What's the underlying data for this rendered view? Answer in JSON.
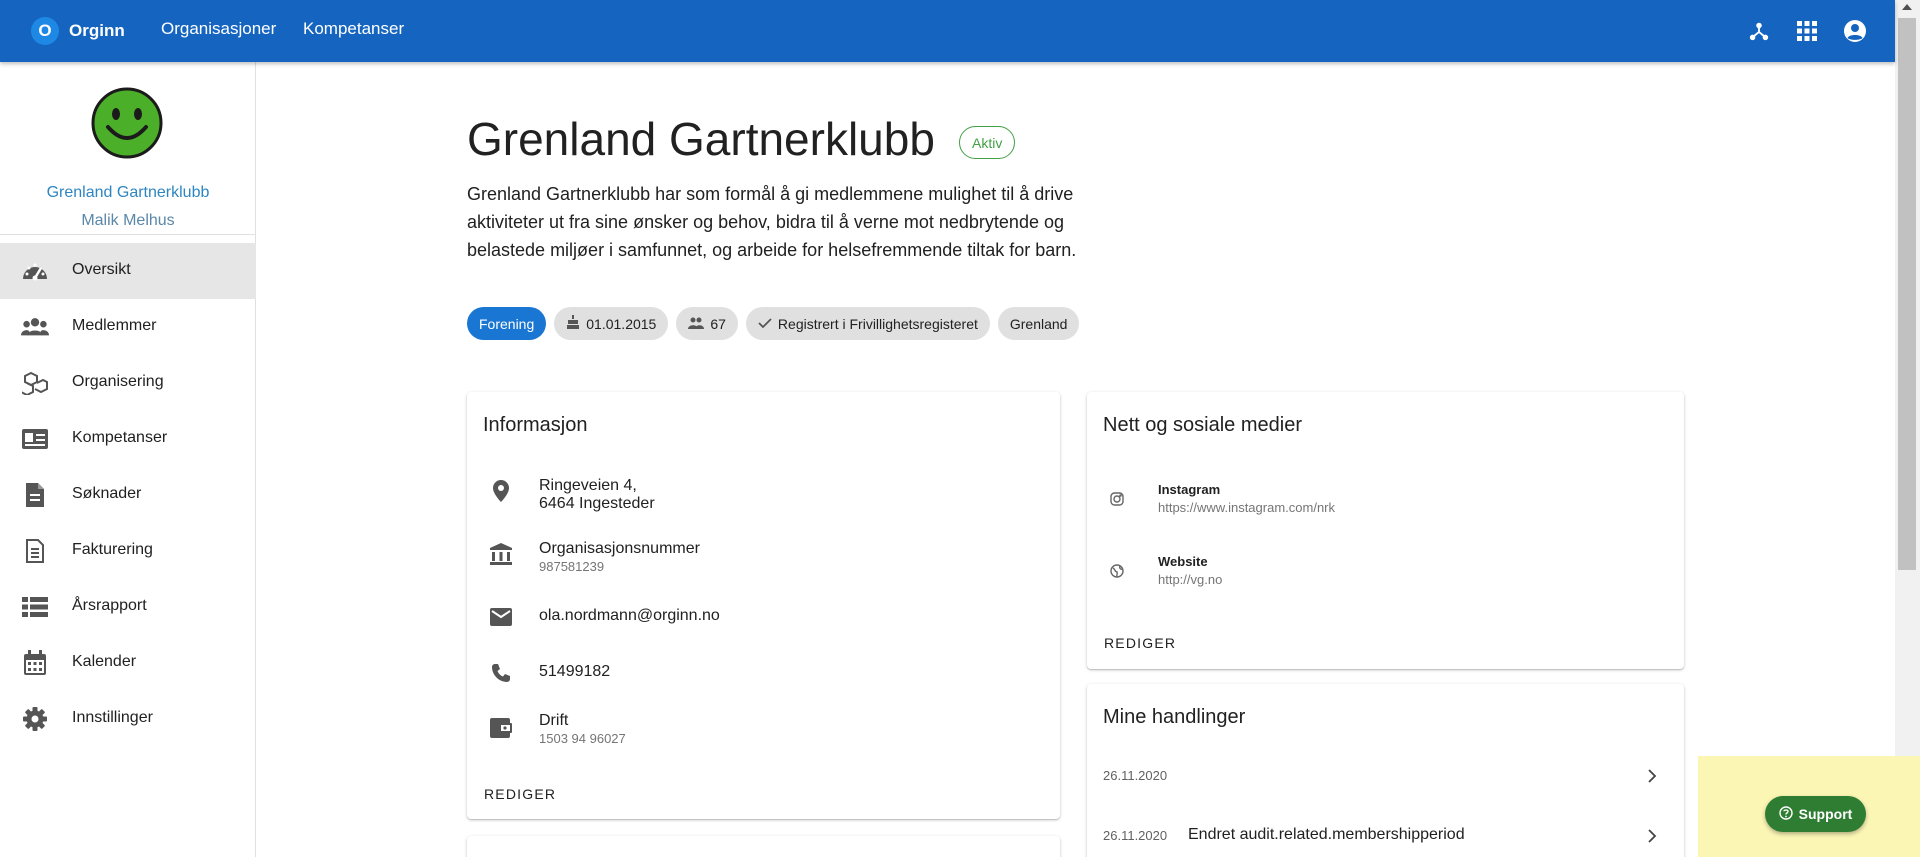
{
  "header": {
    "brand_logo": "O",
    "brand_name": "Orginn",
    "nav": [
      "Organisasjoner",
      "Kompetanser"
    ],
    "icons": [
      "org-tree-icon",
      "apps-grid-icon",
      "account-circle-icon"
    ]
  },
  "sidebar": {
    "org_name": "Grenland Gartnerklubb",
    "user_name": "Malik Melhus",
    "items": [
      {
        "label": "Oversikt",
        "icon": "dashboard-icon",
        "active": true
      },
      {
        "label": "Medlemmer",
        "icon": "people-icon"
      },
      {
        "label": "Organisering",
        "icon": "cubes-icon"
      },
      {
        "label": "Kompetanser",
        "icon": "id-card-icon"
      },
      {
        "label": "Søknader",
        "icon": "document-icon"
      },
      {
        "label": "Fakturering",
        "icon": "invoice-icon"
      },
      {
        "label": "Årsrapport",
        "icon": "list-icon"
      },
      {
        "label": "Kalender",
        "icon": "calendar-icon"
      },
      {
        "label": "Innstillinger",
        "icon": "gear-icon"
      }
    ]
  },
  "main": {
    "title": "Grenland Gartnerklubb",
    "status": "Aktiv",
    "description": "Grenland Gartnerklubb har som formål å gi medlemmene mulighet til å drive aktiviteter ut fra sine ønsker og behov, bidra til å verne mot nedbrytende og belastede miljøer i samfunnet, og arbeide for helsefremmende tiltak for barn.",
    "chips": {
      "type": "Forening",
      "founded": "01.01.2015",
      "members": "67",
      "registered": "Registrert i Frivillighetsregisteret",
      "region": "Grenland"
    }
  },
  "info_card": {
    "title": "Informasjon",
    "address_line1": "Ringeveien 4,",
    "address_line2": "6464 Ingesteder",
    "orgnr_label": "Organisasjonsnummer",
    "orgnr_value": "987581239",
    "email": "ola.nordmann@orginn.no",
    "phone": "51499182",
    "account_label": "Drift",
    "account_value": "1503 94 96027",
    "action": "REDIGER"
  },
  "social_card": {
    "title": "Nett og sosiale medier",
    "instagram_label": "Instagram",
    "instagram_url": "https://www.instagram.com/nrk",
    "website_label": "Website",
    "website_url": "http://vg.no",
    "action": "REDIGER"
  },
  "actions_card": {
    "title": "Mine handlinger",
    "items": [
      {
        "date": "26.11.2020",
        "text": ""
      },
      {
        "date": "26.11.2020",
        "text": "Endret audit.related.membershipperiod"
      }
    ]
  },
  "support": {
    "label": "Support"
  },
  "colors": {
    "appbar": "#1565c0",
    "status_green": "#43a047",
    "primary_chip": "#1976d2",
    "support_button": "#2e7d32",
    "support_area": "#fbf6b4",
    "sidebar_org_link": "#2e86c1"
  }
}
